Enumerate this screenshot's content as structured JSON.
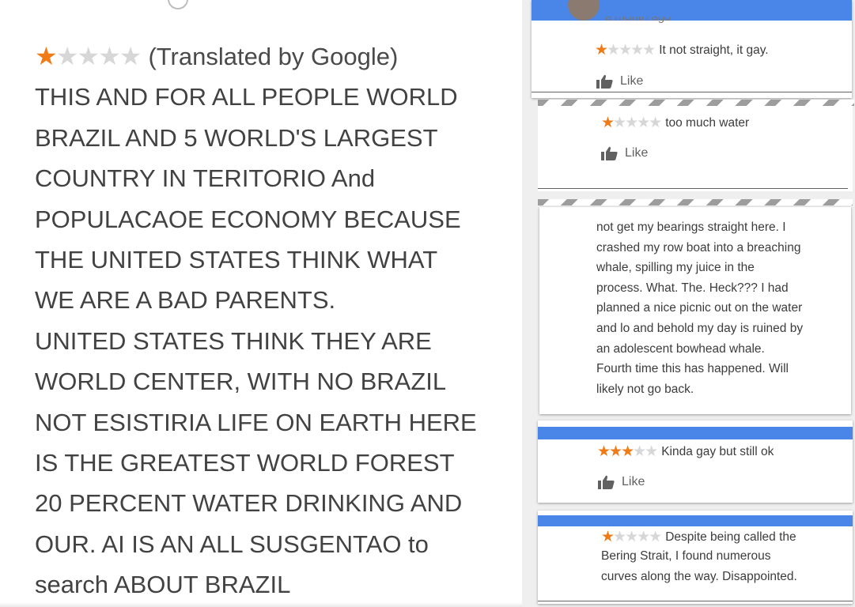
{
  "left_review": {
    "stars_on": "★",
    "stars_off": "★★★★",
    "translated_label": "(Translated by Google)",
    "lines": [
      "THIS AND FOR ALL PEOPLE WORLD",
      "BRAZIL AND 5 WORLD'S LARGEST",
      "COUNTRY IN TERITORIO And",
      "POPULACAOE ECONOMY BECAUSE",
      "THE UNITED STATES THINK WHAT",
      "WE ARE A BAD PARENTS.",
      "UNITED STATES THINK THEY ARE",
      "WORLD CENTER, WITH NO BRAZIL",
      "NOT ESISTIRIA LIFE ON EARTH HERE",
      "IS THE GREATEST WORLD FOREST",
      "20 PERCENT WATER DRINKING AND",
      "OUR. AI IS AN ALL SUSGENTAO to",
      "search ABOUT BRAZIL"
    ]
  },
  "cards": {
    "c1": {
      "ago": "a month ago",
      "stars_on": "★",
      "stars_off": "★★★★",
      "text": "It not straight, it gay.",
      "like": "Like"
    },
    "c2": {
      "stars_on": "★",
      "stars_off": "★★★★",
      "text": "too much water",
      "like": "Like"
    },
    "c3": {
      "lines": [
        "not get my bearings straight here. I",
        "crashed my row boat into a breaching",
        "whale, spilling my juice in the",
        "process. What. The. Heck??? I had",
        "planned a nice picnic out on the water",
        "and lo and behold my day is ruined by",
        "an adolescent bowhead whale.",
        "Fourth time this has happened. Will",
        "likely not go back."
      ]
    },
    "c4": {
      "stars_on": "★★★",
      "stars_off": "★★",
      "text": "Kinda gay but still ok",
      "like": "Like"
    },
    "c5": {
      "stars_on": "★",
      "stars_off": "★★★★",
      "text_line1": "Despite being called the",
      "text_line2": "Bering Strait, I found numerous",
      "text_line3": "curves along the way. Disappointed."
    }
  },
  "colors": {
    "star": "#f07b16",
    "star_off": "#d7d7d7",
    "blue": "#4a86e8"
  }
}
